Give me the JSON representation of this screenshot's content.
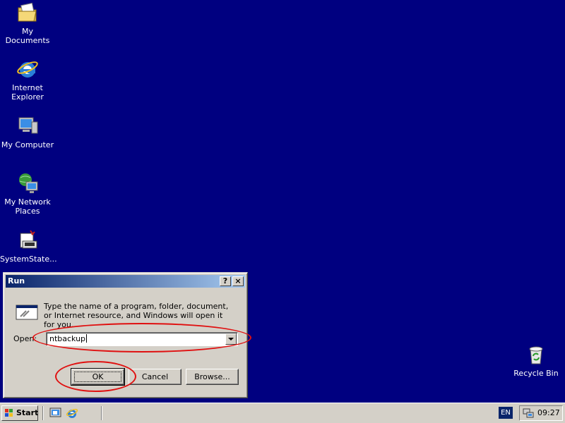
{
  "desktop": {
    "icons": [
      {
        "label": "My Documents"
      },
      {
        "label": "Internet Explorer"
      },
      {
        "label": "My Computer"
      },
      {
        "label": "My Network Places"
      },
      {
        "label": "SystemState..."
      },
      {
        "label": "Recycle Bin"
      }
    ]
  },
  "run_dialog": {
    "title": "Run",
    "help_button": "?",
    "close_button": "×",
    "description": "Type the name of a program, folder, document, or Internet resource, and Windows will open it for you.",
    "open_label": "Open:",
    "open_value": "ntbackup",
    "ok_label": "OK",
    "cancel_label": "Cancel",
    "browse_label": "Browse..."
  },
  "taskbar": {
    "start_label": "Start",
    "language": "EN",
    "clock": "09:27"
  },
  "colors": {
    "desktop": "#000080",
    "title_active_start": "#0a246a",
    "title_active_end": "#a6caf0",
    "annotation": "#e01010"
  }
}
